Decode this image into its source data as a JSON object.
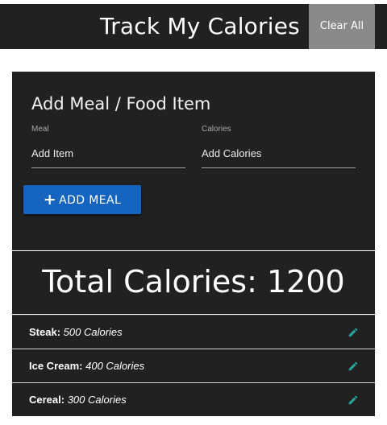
{
  "header": {
    "title": "Track My Calories",
    "clear_label": "Clear All"
  },
  "form": {
    "title": "Add Meal / Food Item",
    "meal_label": "Meal",
    "meal_placeholder": "Add Item",
    "calories_label": "Calories",
    "calories_placeholder": "Add Calories",
    "add_label": "ADD MEAL",
    "add_icon": "plus-icon"
  },
  "total": {
    "text": "Total Calories: 1200"
  },
  "items": [
    {
      "name": "Steak:",
      "calories": "500 Calories",
      "icon": "pencil-icon"
    },
    {
      "name": "Ice Cream:",
      "calories": "400 Calories",
      "icon": "pencil-icon"
    },
    {
      "name": "Cereal:",
      "calories": "300 Calories",
      "icon": "pencil-icon"
    }
  ],
  "colors": {
    "navbar": "#212121",
    "clear_button": "#8a8a8a",
    "card": "#212121",
    "primary_button": "#1565c0",
    "edit_icon": "#26a69a"
  }
}
